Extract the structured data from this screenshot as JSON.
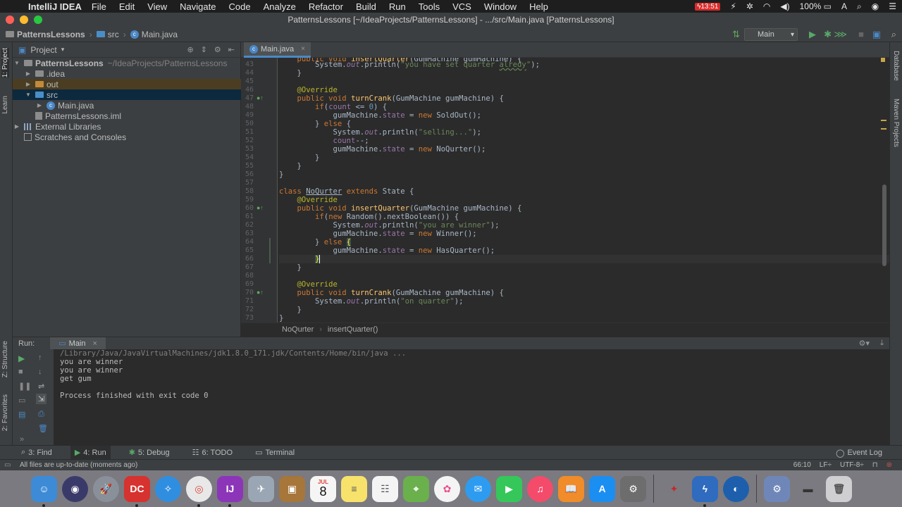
{
  "menubar": {
    "app_name": "IntelliJ IDEA",
    "items": [
      "File",
      "Edit",
      "View",
      "Navigate",
      "Code",
      "Analyze",
      "Refactor",
      "Build",
      "Run",
      "Tools",
      "VCS",
      "Window",
      "Help"
    ],
    "time": "13:51",
    "battery": "100%"
  },
  "window": {
    "title": "PatternsLessons [~/IdeaProjects/PatternsLessons] - .../src/Main.java [PatternsLessons]"
  },
  "navbar": {
    "crumbs": [
      "PatternsLessons",
      "src",
      "Main.java"
    ],
    "run_config": "Main"
  },
  "left_stripe": {
    "project_tab": "1: Project",
    "learn_tab": "Learn",
    "structure_tab": "Z: Structure",
    "favorites_tab": "2: Favorites"
  },
  "right_stripe": {
    "database_tab": "Database",
    "maven_tab": "Maven Projects"
  },
  "project_panel": {
    "title": "Project",
    "tree": {
      "root": "PatternsLessons",
      "root_path": "~/IdeaProjects/PatternsLessons",
      "idea": ".idea",
      "out": "out",
      "src": "src",
      "main": "Main.java",
      "iml": "PatternsLessons.iml",
      "libs": "External Libraries",
      "scratches": "Scratches and Consoles"
    }
  },
  "editor": {
    "tab": "Main.java",
    "line_numbers": [
      "43",
      "44",
      "45",
      "46",
      "47",
      "48",
      "49",
      "50",
      "51",
      "52",
      "53",
      "54",
      "55",
      "56",
      "57",
      "58",
      "59",
      "60",
      "61",
      "62",
      "63",
      "64",
      "65",
      "66",
      "67",
      "68",
      "69",
      "70",
      "71",
      "72",
      "73"
    ],
    "breadcrumb": [
      "NoQurter",
      "insertQuarter()"
    ]
  },
  "run_panel": {
    "label": "Run:",
    "tab": "Main",
    "console": [
      "/Library/Java/JavaVirtualMachines/jdk1.8.0_171.jdk/Contents/Home/bin/java ...",
      "you are winner",
      "you are winner",
      "get gum",
      "",
      "Process finished with exit code 0"
    ]
  },
  "tool_tabs": {
    "find": "3: Find",
    "run": "4: Run",
    "debug": "5: Debug",
    "todo": "6: TODO",
    "terminal": "Terminal",
    "event_log": "Event Log"
  },
  "statusbar": {
    "message": "All files are up-to-date (moments ago)",
    "position": "66:10",
    "line_sep": "LF÷",
    "encoding": "UTF-8÷"
  },
  "dock": {
    "calendar_month": "JUL",
    "calendar_day": "8"
  }
}
